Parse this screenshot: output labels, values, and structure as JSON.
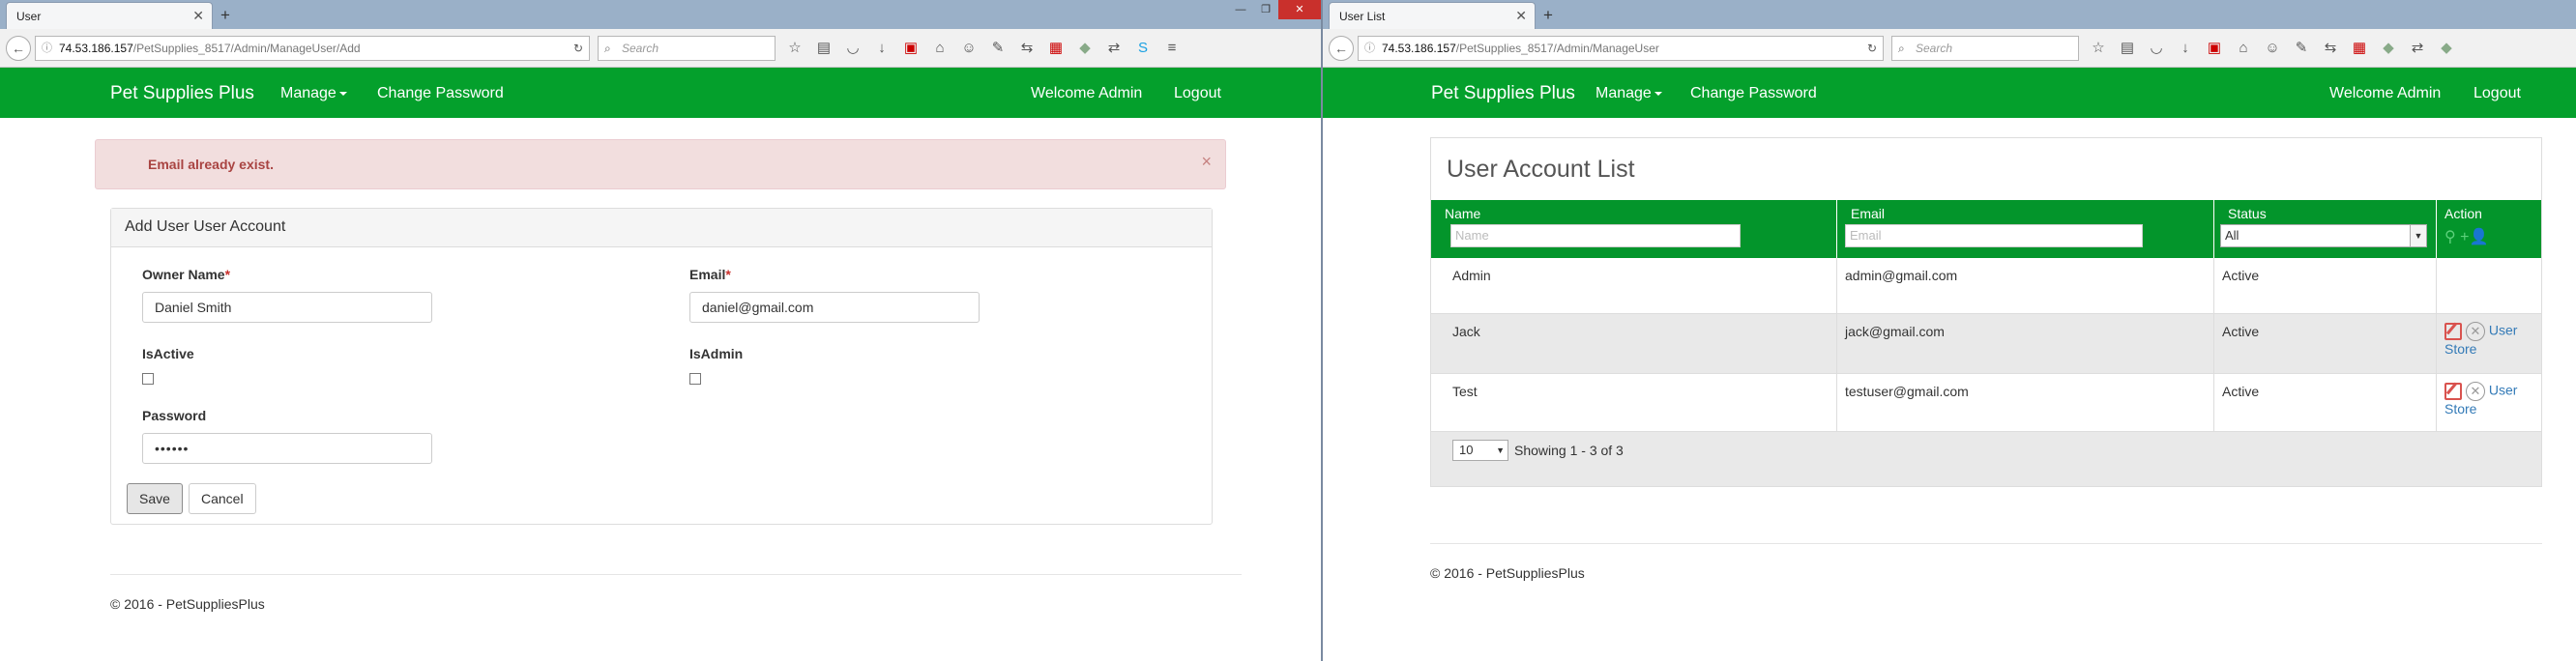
{
  "left": {
    "tab_title": "User",
    "url_host": "74.53.186.157",
    "url_path": "/PetSupplies_8517/Admin/ManageUser/Add",
    "search_placeholder": "Search",
    "brand": "Pet Supplies Plus",
    "nav": {
      "manage": "Manage",
      "change_password": "Change Password",
      "welcome": "Welcome Admin",
      "logout": "Logout"
    },
    "alert": {
      "message": "Email already exist.",
      "close": "×"
    },
    "panel_title": "Add User User Account",
    "form": {
      "owner_name_label": "Owner Name",
      "owner_name_value": "Daniel Smith",
      "email_label": "Email",
      "email_value": "daniel@gmail.com",
      "required_mark": "*",
      "isactive_label": "IsActive",
      "isadmin_label": "IsAdmin",
      "password_label": "Password",
      "password_value": "••••••",
      "save_label": "Save",
      "cancel_label": "Cancel"
    },
    "footer": "© 2016 - PetSuppliesPlus"
  },
  "right": {
    "tab_title": "User List",
    "url_host": "74.53.186.157",
    "url_path": "/PetSupplies_8517/Admin/ManageUser",
    "search_placeholder": "Search",
    "brand": "Pet Supplies Plus",
    "nav": {
      "manage": "Manage",
      "change_password": "Change Password",
      "welcome": "Welcome Admin",
      "logout": "Logout"
    },
    "list_title": "User Account List",
    "columns": {
      "name": "Name",
      "email": "Email",
      "status": "Status",
      "action": "Action"
    },
    "filters": {
      "name_placeholder": "Name",
      "email_placeholder": "Email",
      "status_value": "All"
    },
    "rows": [
      {
        "name": "Admin",
        "email": "admin@gmail.com",
        "status": "Active",
        "has_actions": false
      },
      {
        "name": "Jack",
        "email": "jack@gmail.com",
        "status": "Active",
        "has_actions": true,
        "action_user": "User",
        "action_store": "Store"
      },
      {
        "name": "Test",
        "email": "testuser@gmail.com",
        "status": "Active",
        "has_actions": true,
        "action_user": "User",
        "action_store": "Store"
      }
    ],
    "page_size": "10",
    "showing": "Showing 1 - 3 of 3",
    "footer": "© 2016 - PetSuppliesPlus"
  },
  "colors": {
    "brand_green": "#04a02c",
    "header_green": "#03952b",
    "alert_bg": "#f2dede",
    "alert_text": "#a94442"
  }
}
